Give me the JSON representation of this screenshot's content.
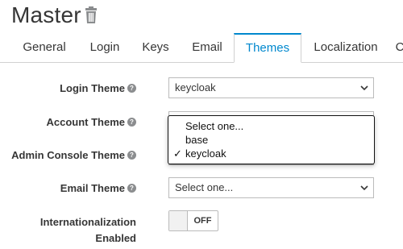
{
  "header": {
    "title": "Master"
  },
  "tabs": [
    {
      "label": "General"
    },
    {
      "label": "Login"
    },
    {
      "label": "Keys"
    },
    {
      "label": "Email"
    },
    {
      "label": "Themes"
    },
    {
      "label": "Localization"
    },
    {
      "label": "C"
    }
  ],
  "active_tab": "Themes",
  "form": {
    "login_theme": {
      "label": "Login Theme",
      "value": "keycloak"
    },
    "account_theme": {
      "label": "Account Theme",
      "value": ""
    },
    "admin_console_theme": {
      "label": "Admin Console Theme",
      "value": ""
    },
    "email_theme": {
      "label": "Email Theme",
      "value": "Select one..."
    },
    "internationalization": {
      "label_line1": "Internationalization",
      "label_line2": "Enabled",
      "state": "OFF"
    }
  },
  "dropdown": {
    "options": [
      "Select one...",
      "base",
      "keycloak"
    ],
    "selected": "keycloak",
    "check_mark": "✓"
  },
  "help_icon": "?",
  "colors": {
    "accent": "#0088ce",
    "text": "#363636",
    "border": "#bbbbbb"
  }
}
